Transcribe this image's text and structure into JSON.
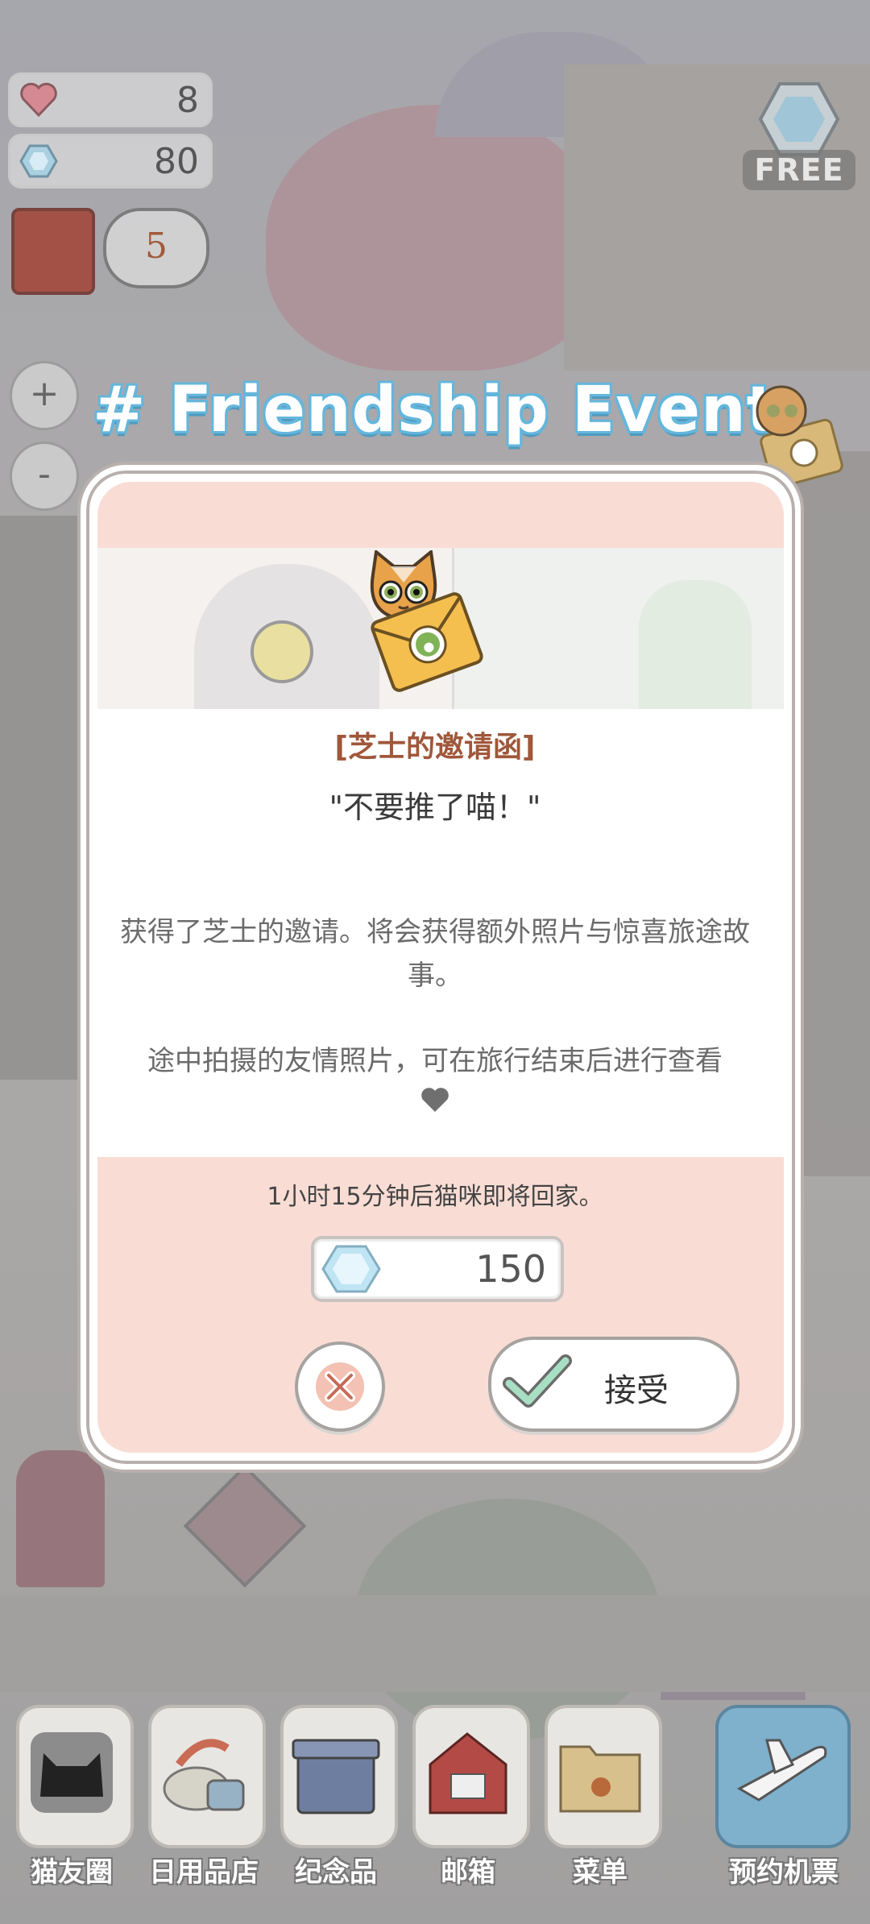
{
  "hud": {
    "hearts": "8",
    "gems": "80",
    "mail_count": "5",
    "zoom_in": "+",
    "zoom_out": "-",
    "free_label": "FREE"
  },
  "event": {
    "title": "# Friendship Event"
  },
  "dialog": {
    "invite_title": "[芝士的邀请函]",
    "quote": "\"不要推了喵！\"",
    "description": "获得了芝士的邀请。将会获得额外照片与惊喜旅途故事。",
    "note": "途中拍摄的友情照片，可在旅行结束后进行查看",
    "timer": "1小时15分钟后猫咪即将回家。",
    "cost": "150",
    "accept_label": "接受"
  },
  "nav": {
    "items": [
      {
        "label": "猫友圈",
        "icon": "cat-friends-icon"
      },
      {
        "label": "日用品店",
        "icon": "shop-icon"
      },
      {
        "label": "纪念品",
        "icon": "souvenir-box-icon"
      },
      {
        "label": "邮箱",
        "icon": "mailbox-icon"
      },
      {
        "label": "菜单",
        "icon": "folder-icon"
      },
      {
        "label": "预约机票",
        "icon": "airplane-icon"
      }
    ]
  },
  "colors": {
    "accent_peach": "#f9ddd4",
    "title_brown": "#a0573a",
    "event_blue": "#67b7dd"
  }
}
